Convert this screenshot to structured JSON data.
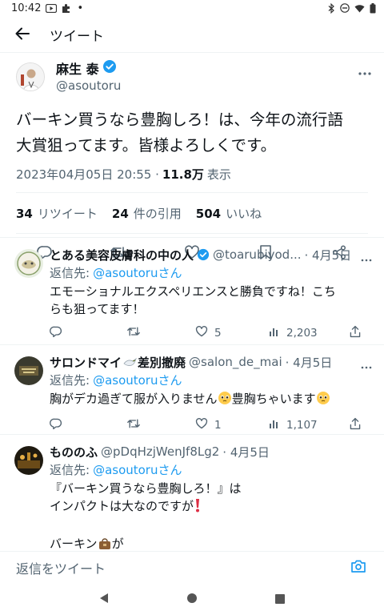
{
  "status_bar": {
    "time": "10:42",
    "dot": "•"
  },
  "header": {
    "title": "ツイート"
  },
  "tweet": {
    "author_name": "麻生 泰",
    "author_handle": "@asoutoru",
    "text_line1": "バーキン買うなら豊胸しろ！は、今年の流行語",
    "text_line2": "大賞狙ってます。皆様よろしくです。",
    "timestamp": "2023年04月05日 20:55 · ",
    "views_count": "11.8万",
    "views_label": "表示",
    "stats": {
      "retweets_count": "34",
      "retweets_label": "リツイート",
      "quotes_count": "24",
      "quotes_label": "件の引用",
      "likes_count": "504",
      "likes_label": "いいね"
    }
  },
  "replies": [
    {
      "name": "とある美容皮膚科の中の人",
      "handle": "@toarubiyod...",
      "time": "· 4月5日",
      "replying_to_label": "返信先:",
      "replying_to": "@asoutoruさん",
      "text_line1": "エモーショナルエクスペリエンスと勝負ですね！こち",
      "text_line2": "らも狙ってます！",
      "retweets": "",
      "likes": "5",
      "views": "2,203"
    },
    {
      "name": "サロンドマイ",
      "name_suffix": "差別撤廃",
      "handle": "@salon_de_mai",
      "time": "· 4月5日",
      "replying_to_label": "返信先:",
      "replying_to": "@asoutoruさん",
      "text_a": "胸がデカ過ぎて服が入りません",
      "text_b": "豊胸ちゃいます",
      "retweets": "",
      "likes": "1",
      "views": "1,107"
    },
    {
      "name": "もののふ",
      "handle": "@pDqHzjWenJf8Lg2",
      "time": "· 4月5日",
      "replying_to_label": "返信先:",
      "replying_to": "@asoutoruさん",
      "text_line1": "『バーキン買うなら豊胸しろ！』は",
      "text_line2": "インパクトは大なのですが",
      "text_line3": "バーキン",
      "text_line3b": "が"
    }
  ],
  "reply_bar": {
    "placeholder": "返信をツイート"
  },
  "colors": {
    "accent": "#1d9bf0",
    "secondary_text": "#536471",
    "divider": "#eff3f4"
  },
  "icons": [
    "back-arrow-icon",
    "more-icon",
    "verified-badge-icon",
    "reply-icon",
    "retweet-icon",
    "like-icon",
    "bookmark-icon",
    "share-icon",
    "views-icon",
    "camera-icon"
  ]
}
